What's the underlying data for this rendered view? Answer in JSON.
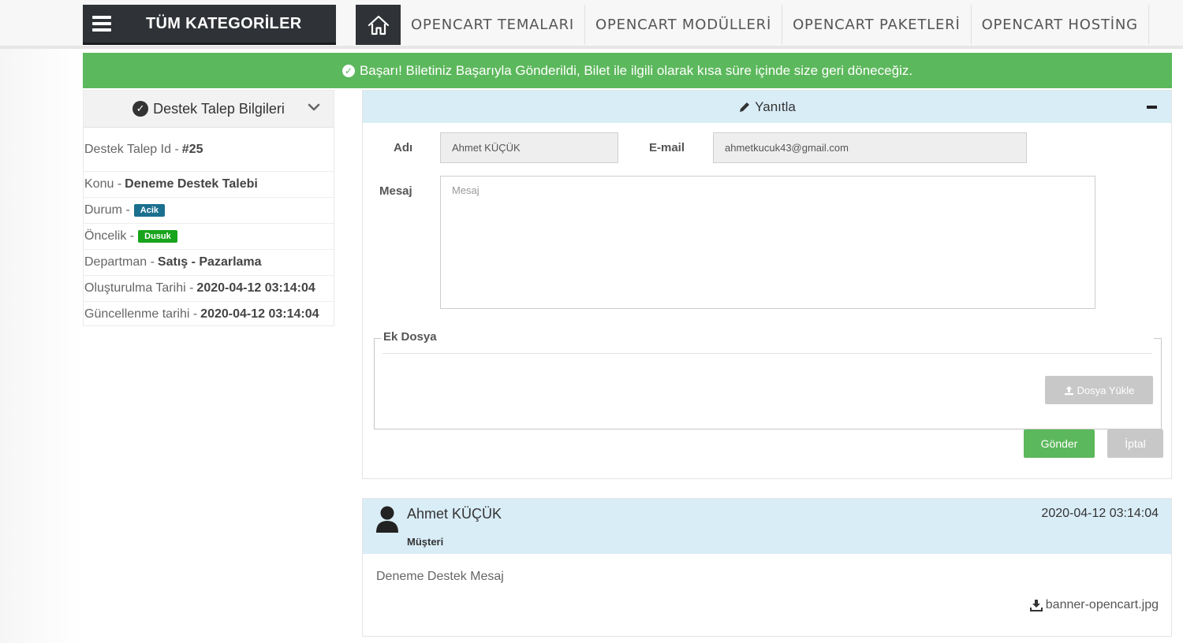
{
  "topbar": {
    "all_categories": "TÜM KATEGORİLER",
    "nav": [
      "OPENCART TEMALARI",
      "OPENCART MODÜLLERİ",
      "OPENCART PAKETLERİ",
      "OPENCART HOSTİNG"
    ]
  },
  "alert": {
    "text": "Başarı! Biletiniz Başarıyla Gönderildi, Bilet ile ilgili olarak kısa süre içinde size geri döneceğiz.",
    "color": "#5cb85c"
  },
  "ticket_info": {
    "title": "Destek Talep Bilgileri",
    "id_label": "Destek Talep Id -",
    "id_value": "#25",
    "subject_label": "Konu -",
    "subject_value": "Deneme Destek Talebi",
    "status_label": "Durum -",
    "status_value": "Acik",
    "status_color": "#1b6f8f",
    "priority_label": "Öncelik -",
    "priority_value": "Dusuk",
    "priority_color": "#18a41d",
    "dept_label": "Departman -",
    "dept_value": "Satış - Pazarlama",
    "created_label": "Oluşturulma Tarihi -",
    "created_value": "2020-04-12 03:14:04",
    "updated_label": "Güncellenme tarihi -",
    "updated_value": "2020-04-12 03:14:04"
  },
  "reply": {
    "title": "Yanıtla",
    "name_label": "Adı",
    "name_value": "Ahmet KÜÇÜK",
    "email_label": "E-mail",
    "email_value": "ahmetkucuk43@gmail.com",
    "message_label": "Mesaj",
    "message_placeholder": "Mesaj",
    "attachment_label": "Ek Dosya",
    "upload_button": "Dosya Yükle",
    "send_button": "Gönder",
    "cancel_button": "İptal"
  },
  "message": {
    "author": "Ahmet KÜÇÜK",
    "role": "Müşteri",
    "date": "2020-04-12 03:14:04",
    "body": "Deneme Destek Mesaj",
    "attachment": "banner-opencart.jpg"
  }
}
